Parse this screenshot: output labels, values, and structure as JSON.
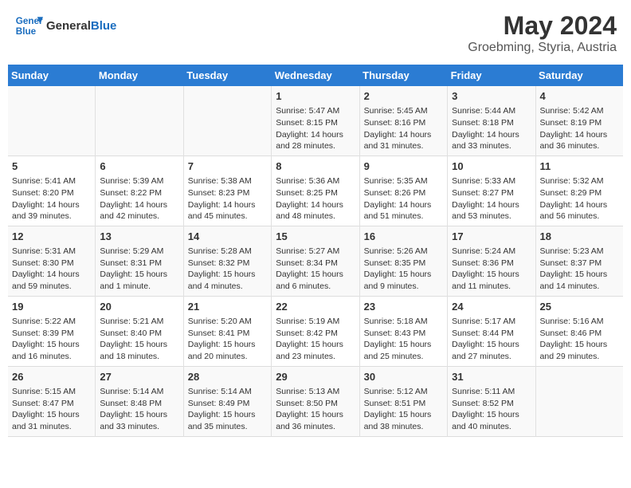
{
  "header": {
    "logo_line1": "General",
    "logo_line2": "Blue",
    "title": "May 2024",
    "subtitle": "Groebming, Styria, Austria"
  },
  "days_of_week": [
    "Sunday",
    "Monday",
    "Tuesday",
    "Wednesday",
    "Thursday",
    "Friday",
    "Saturday"
  ],
  "weeks": [
    [
      {
        "num": "",
        "info": ""
      },
      {
        "num": "",
        "info": ""
      },
      {
        "num": "",
        "info": ""
      },
      {
        "num": "1",
        "info": "Sunrise: 5:47 AM\nSunset: 8:15 PM\nDaylight: 14 hours\nand 28 minutes."
      },
      {
        "num": "2",
        "info": "Sunrise: 5:45 AM\nSunset: 8:16 PM\nDaylight: 14 hours\nand 31 minutes."
      },
      {
        "num": "3",
        "info": "Sunrise: 5:44 AM\nSunset: 8:18 PM\nDaylight: 14 hours\nand 33 minutes."
      },
      {
        "num": "4",
        "info": "Sunrise: 5:42 AM\nSunset: 8:19 PM\nDaylight: 14 hours\nand 36 minutes."
      }
    ],
    [
      {
        "num": "5",
        "info": "Sunrise: 5:41 AM\nSunset: 8:20 PM\nDaylight: 14 hours\nand 39 minutes."
      },
      {
        "num": "6",
        "info": "Sunrise: 5:39 AM\nSunset: 8:22 PM\nDaylight: 14 hours\nand 42 minutes."
      },
      {
        "num": "7",
        "info": "Sunrise: 5:38 AM\nSunset: 8:23 PM\nDaylight: 14 hours\nand 45 minutes."
      },
      {
        "num": "8",
        "info": "Sunrise: 5:36 AM\nSunset: 8:25 PM\nDaylight: 14 hours\nand 48 minutes."
      },
      {
        "num": "9",
        "info": "Sunrise: 5:35 AM\nSunset: 8:26 PM\nDaylight: 14 hours\nand 51 minutes."
      },
      {
        "num": "10",
        "info": "Sunrise: 5:33 AM\nSunset: 8:27 PM\nDaylight: 14 hours\nand 53 minutes."
      },
      {
        "num": "11",
        "info": "Sunrise: 5:32 AM\nSunset: 8:29 PM\nDaylight: 14 hours\nand 56 minutes."
      }
    ],
    [
      {
        "num": "12",
        "info": "Sunrise: 5:31 AM\nSunset: 8:30 PM\nDaylight: 14 hours\nand 59 minutes."
      },
      {
        "num": "13",
        "info": "Sunrise: 5:29 AM\nSunset: 8:31 PM\nDaylight: 15 hours\nand 1 minute."
      },
      {
        "num": "14",
        "info": "Sunrise: 5:28 AM\nSunset: 8:32 PM\nDaylight: 15 hours\nand 4 minutes."
      },
      {
        "num": "15",
        "info": "Sunrise: 5:27 AM\nSunset: 8:34 PM\nDaylight: 15 hours\nand 6 minutes."
      },
      {
        "num": "16",
        "info": "Sunrise: 5:26 AM\nSunset: 8:35 PM\nDaylight: 15 hours\nand 9 minutes."
      },
      {
        "num": "17",
        "info": "Sunrise: 5:24 AM\nSunset: 8:36 PM\nDaylight: 15 hours\nand 11 minutes."
      },
      {
        "num": "18",
        "info": "Sunrise: 5:23 AM\nSunset: 8:37 PM\nDaylight: 15 hours\nand 14 minutes."
      }
    ],
    [
      {
        "num": "19",
        "info": "Sunrise: 5:22 AM\nSunset: 8:39 PM\nDaylight: 15 hours\nand 16 minutes."
      },
      {
        "num": "20",
        "info": "Sunrise: 5:21 AM\nSunset: 8:40 PM\nDaylight: 15 hours\nand 18 minutes."
      },
      {
        "num": "21",
        "info": "Sunrise: 5:20 AM\nSunset: 8:41 PM\nDaylight: 15 hours\nand 20 minutes."
      },
      {
        "num": "22",
        "info": "Sunrise: 5:19 AM\nSunset: 8:42 PM\nDaylight: 15 hours\nand 23 minutes."
      },
      {
        "num": "23",
        "info": "Sunrise: 5:18 AM\nSunset: 8:43 PM\nDaylight: 15 hours\nand 25 minutes."
      },
      {
        "num": "24",
        "info": "Sunrise: 5:17 AM\nSunset: 8:44 PM\nDaylight: 15 hours\nand 27 minutes."
      },
      {
        "num": "25",
        "info": "Sunrise: 5:16 AM\nSunset: 8:46 PM\nDaylight: 15 hours\nand 29 minutes."
      }
    ],
    [
      {
        "num": "26",
        "info": "Sunrise: 5:15 AM\nSunset: 8:47 PM\nDaylight: 15 hours\nand 31 minutes."
      },
      {
        "num": "27",
        "info": "Sunrise: 5:14 AM\nSunset: 8:48 PM\nDaylight: 15 hours\nand 33 minutes."
      },
      {
        "num": "28",
        "info": "Sunrise: 5:14 AM\nSunset: 8:49 PM\nDaylight: 15 hours\nand 35 minutes."
      },
      {
        "num": "29",
        "info": "Sunrise: 5:13 AM\nSunset: 8:50 PM\nDaylight: 15 hours\nand 36 minutes."
      },
      {
        "num": "30",
        "info": "Sunrise: 5:12 AM\nSunset: 8:51 PM\nDaylight: 15 hours\nand 38 minutes."
      },
      {
        "num": "31",
        "info": "Sunrise: 5:11 AM\nSunset: 8:52 PM\nDaylight: 15 hours\nand 40 minutes."
      },
      {
        "num": "",
        "info": ""
      }
    ]
  ]
}
